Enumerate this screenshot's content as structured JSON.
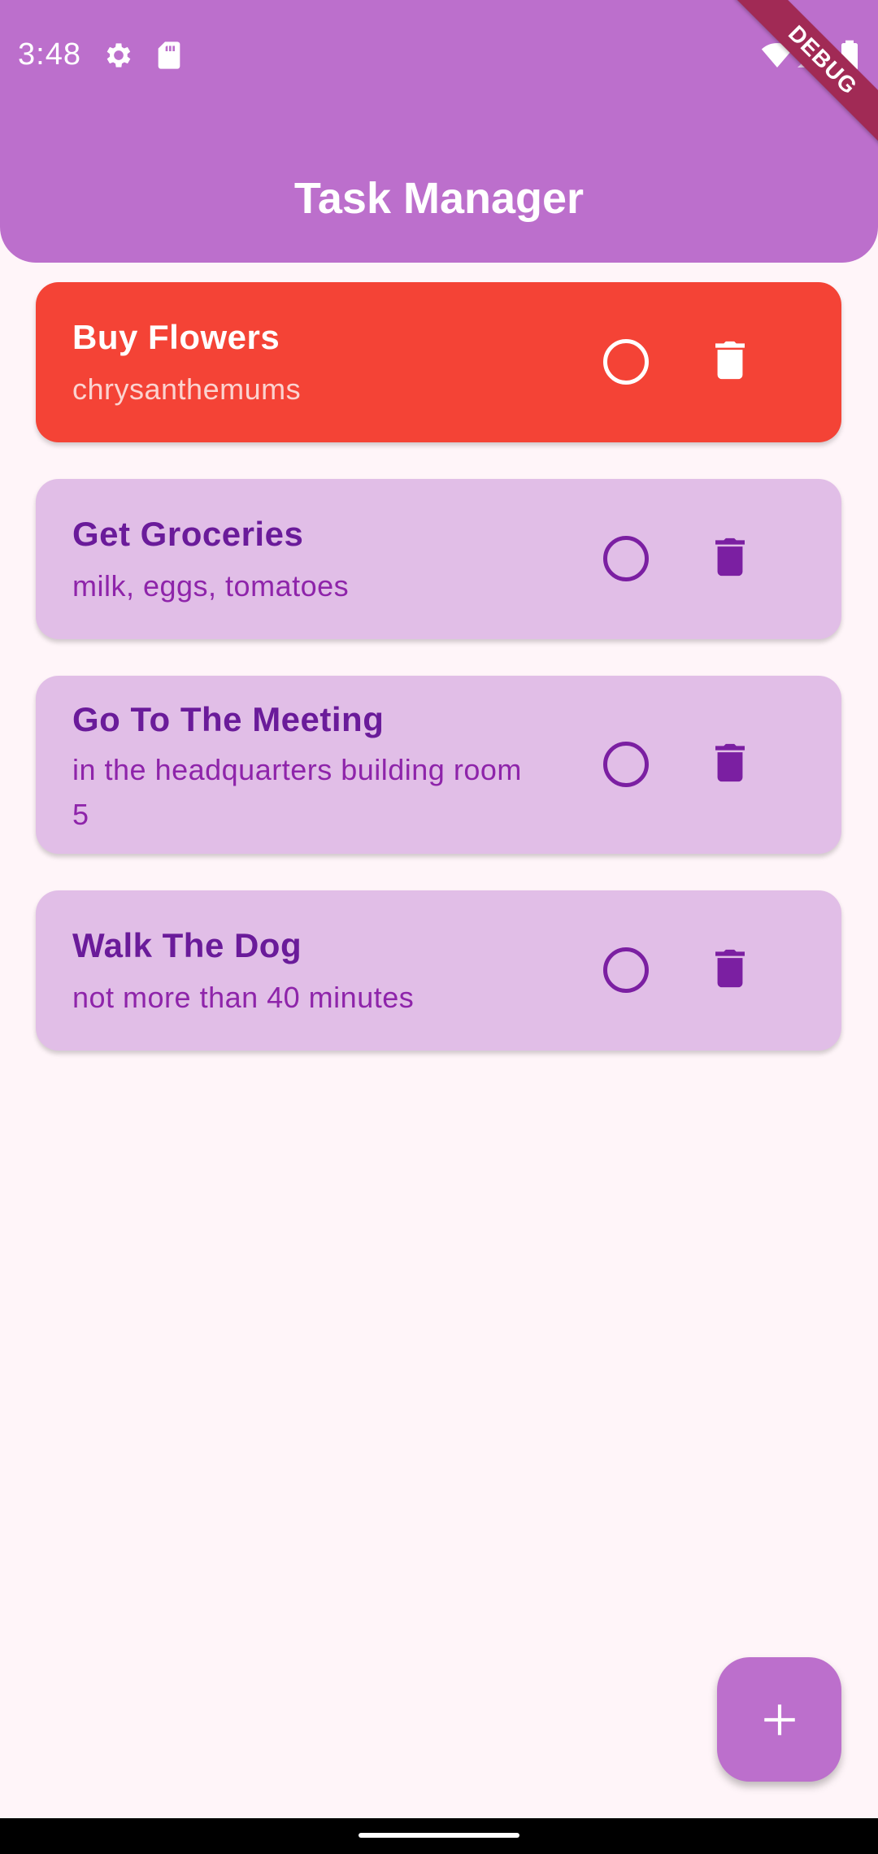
{
  "status_bar": {
    "time": "3:48",
    "icons": [
      "gear-icon",
      "sd-card-icon",
      "wifi-icon",
      "signal-icon",
      "battery-icon"
    ]
  },
  "app_bar": {
    "title": "Task Manager",
    "color": "#bc6fcc"
  },
  "debug_banner": "DEBUG",
  "tasks": [
    {
      "title": "Buy Flowers",
      "description": "chrysanthemums",
      "highlighted": true,
      "done": false
    },
    {
      "title": "Get Groceries",
      "description": "milk, eggs, tomatoes",
      "highlighted": false,
      "done": false
    },
    {
      "title": "Go To The Meeting",
      "description": "in the headquarters building room 5",
      "highlighted": false,
      "done": false
    },
    {
      "title": "Walk The Dog",
      "description": "not more than 40 minutes",
      "highlighted": false,
      "done": false
    }
  ],
  "fab": {
    "label": "+",
    "icon": "plus-icon"
  },
  "colors": {
    "highlight_card": "#f44336",
    "card": "#e1bee7",
    "accent": "#7b1fa2",
    "background": "#fff5f9"
  }
}
